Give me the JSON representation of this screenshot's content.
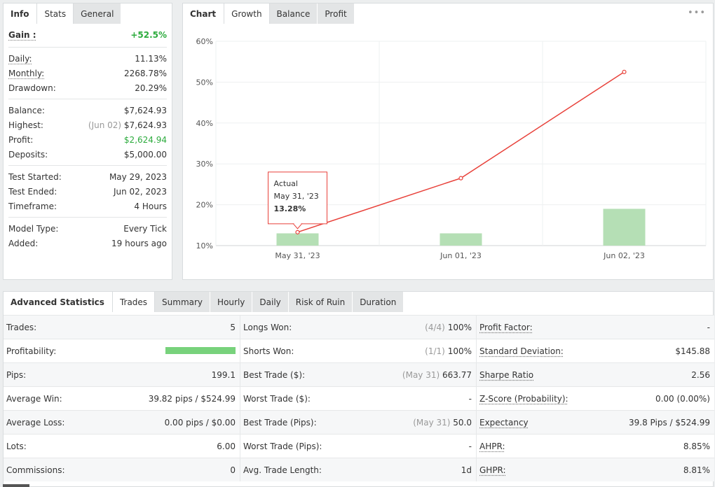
{
  "info": {
    "tabs": [
      "Info",
      "Stats",
      "General"
    ],
    "gain": {
      "label": "Gain :",
      "value": "+52.5%"
    },
    "rows1": [
      {
        "label": "Daily:",
        "value": "11.13%"
      },
      {
        "label": "Monthly:",
        "value": "2268.78%"
      },
      {
        "label": "Drawdown:",
        "value": "20.29%"
      }
    ],
    "balance": {
      "label": "Balance:",
      "value": "$7,624.93"
    },
    "highest": {
      "label": "Highest:",
      "date": "(Jun 02)",
      "value": "$7,624.93"
    },
    "profit": {
      "label": "Profit:",
      "value": "$2,624.94"
    },
    "deposits": {
      "label": "Deposits:",
      "value": "$5,000.00"
    },
    "rows3": [
      {
        "label": "Test Started:",
        "value": "May 29, 2023"
      },
      {
        "label": "Test Ended:",
        "value": "Jun 02, 2023"
      },
      {
        "label": "Timeframe:",
        "value": "4 Hours"
      }
    ],
    "rows4": [
      {
        "label": "Model Type:",
        "value": "Every Tick"
      },
      {
        "label": "Added:",
        "value": "19 hours ago"
      }
    ]
  },
  "chart_panel": {
    "tabs": [
      "Chart",
      "Growth",
      "Balance",
      "Profit"
    ],
    "more": "•••",
    "tooltip": {
      "title": "Actual",
      "date": "May 31, '23",
      "value": "13.28%"
    }
  },
  "chart_data": {
    "type": "line",
    "categories": [
      "May 31, '23",
      "Jun 01, '23",
      "Jun 02, '23"
    ],
    "series": [
      {
        "name": "Actual",
        "type": "line",
        "color": "#e8413a",
        "values": [
          13.28,
          26.5,
          52.5
        ]
      },
      {
        "type": "bar",
        "color": "#b5dfb5",
        "values": [
          13.0,
          13.0,
          19.0
        ]
      }
    ],
    "yticks": [
      "60%",
      "50%",
      "40%",
      "30%",
      "20%",
      "10%"
    ],
    "ylim": [
      10,
      60
    ],
    "grid": true
  },
  "advanced": {
    "tabs": [
      "Advanced Statistics",
      "Trades",
      "Summary",
      "Hourly",
      "Daily",
      "Risk of Ruin",
      "Duration"
    ],
    "rows": [
      [
        {
          "k": "Trades:",
          "v": "5"
        },
        {
          "k": "Longs Won:",
          "sub": "(4/4)",
          "v": "100%"
        },
        {
          "k": "Profit Factor:",
          "v": "-",
          "u": true
        }
      ],
      [
        {
          "k": "Profitability:",
          "bar": 1.0
        },
        {
          "k": "Shorts Won:",
          "sub": "(1/1)",
          "v": "100%"
        },
        {
          "k": "Standard Deviation:",
          "v": "$145.88",
          "u": true
        }
      ],
      [
        {
          "k": "Pips:",
          "v": "199.1"
        },
        {
          "k": "Best Trade ($):",
          "sub": "(May 31)",
          "v": "663.77"
        },
        {
          "k": "Sharpe Ratio",
          "v": "2.56",
          "u": true
        }
      ],
      [
        {
          "k": "Average Win:",
          "v": "39.82 pips / $524.99"
        },
        {
          "k": "Worst Trade ($):",
          "v": "-"
        },
        {
          "k": "Z-Score (Probability):",
          "v": "0.00 (0.00%)",
          "u": true
        }
      ],
      [
        {
          "k": "Average Loss:",
          "v": "0.00 pips / $0.00"
        },
        {
          "k": "Best Trade (Pips):",
          "sub": "(May 31)",
          "v": "50.0"
        },
        {
          "k": "Expectancy",
          "v": "39.8 Pips / $524.99",
          "u": true
        }
      ],
      [
        {
          "k": "Lots:",
          "v": "6.00"
        },
        {
          "k": "Worst Trade (Pips):",
          "v": "-"
        },
        {
          "k": "AHPR:",
          "v": "8.85%",
          "u": true
        }
      ],
      [
        {
          "k": "Commissions:",
          "v": "0"
        },
        {
          "k": "Avg. Trade Length:",
          "v": "1d"
        },
        {
          "k": "GHPR:",
          "v": "8.81%",
          "u": true
        }
      ]
    ]
  }
}
